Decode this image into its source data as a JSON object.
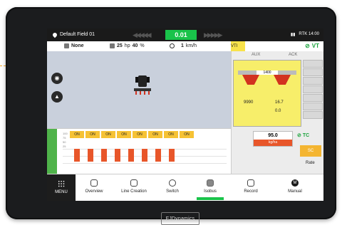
{
  "status_bar": {
    "field_name": "Default Field 01",
    "xte_value": "0.01",
    "right_status": "RTK 14:00"
  },
  "info_bar": {
    "profile": "None",
    "power": "25",
    "power_unit": "hp",
    "percent": "40",
    "percent_unit": "%",
    "speed": "1",
    "speed_unit": "km/h",
    "vt_tab": "VTI",
    "vt_status": "VT"
  },
  "vt_panel": {
    "aux_left": "AUX",
    "aux_right": "ACK",
    "bar_value": "1400",
    "val1": "9990",
    "val2": "16.7",
    "val3": "0.0"
  },
  "sections": {
    "on_label": "ON",
    "count": 8,
    "scale": [
      "100",
      "75",
      "50",
      "25"
    ]
  },
  "rate_panel": {
    "value": "95.0",
    "unit": "kg/ha",
    "tc": "TC",
    "sc": "SC",
    "rate": "Rate"
  },
  "nav": {
    "menu": "MENU",
    "overview": "Overview",
    "line_creation": "Line Creation",
    "switch": "Switch",
    "isobus": "Isobus",
    "record": "Record",
    "manual": "Manual"
  },
  "brand": "FJDynamics",
  "colors": {
    "accent_green": "#19c34a",
    "section_on": "#f6c234",
    "rate_red": "#e8562a",
    "vt_yellow": "#f7ee6a"
  }
}
